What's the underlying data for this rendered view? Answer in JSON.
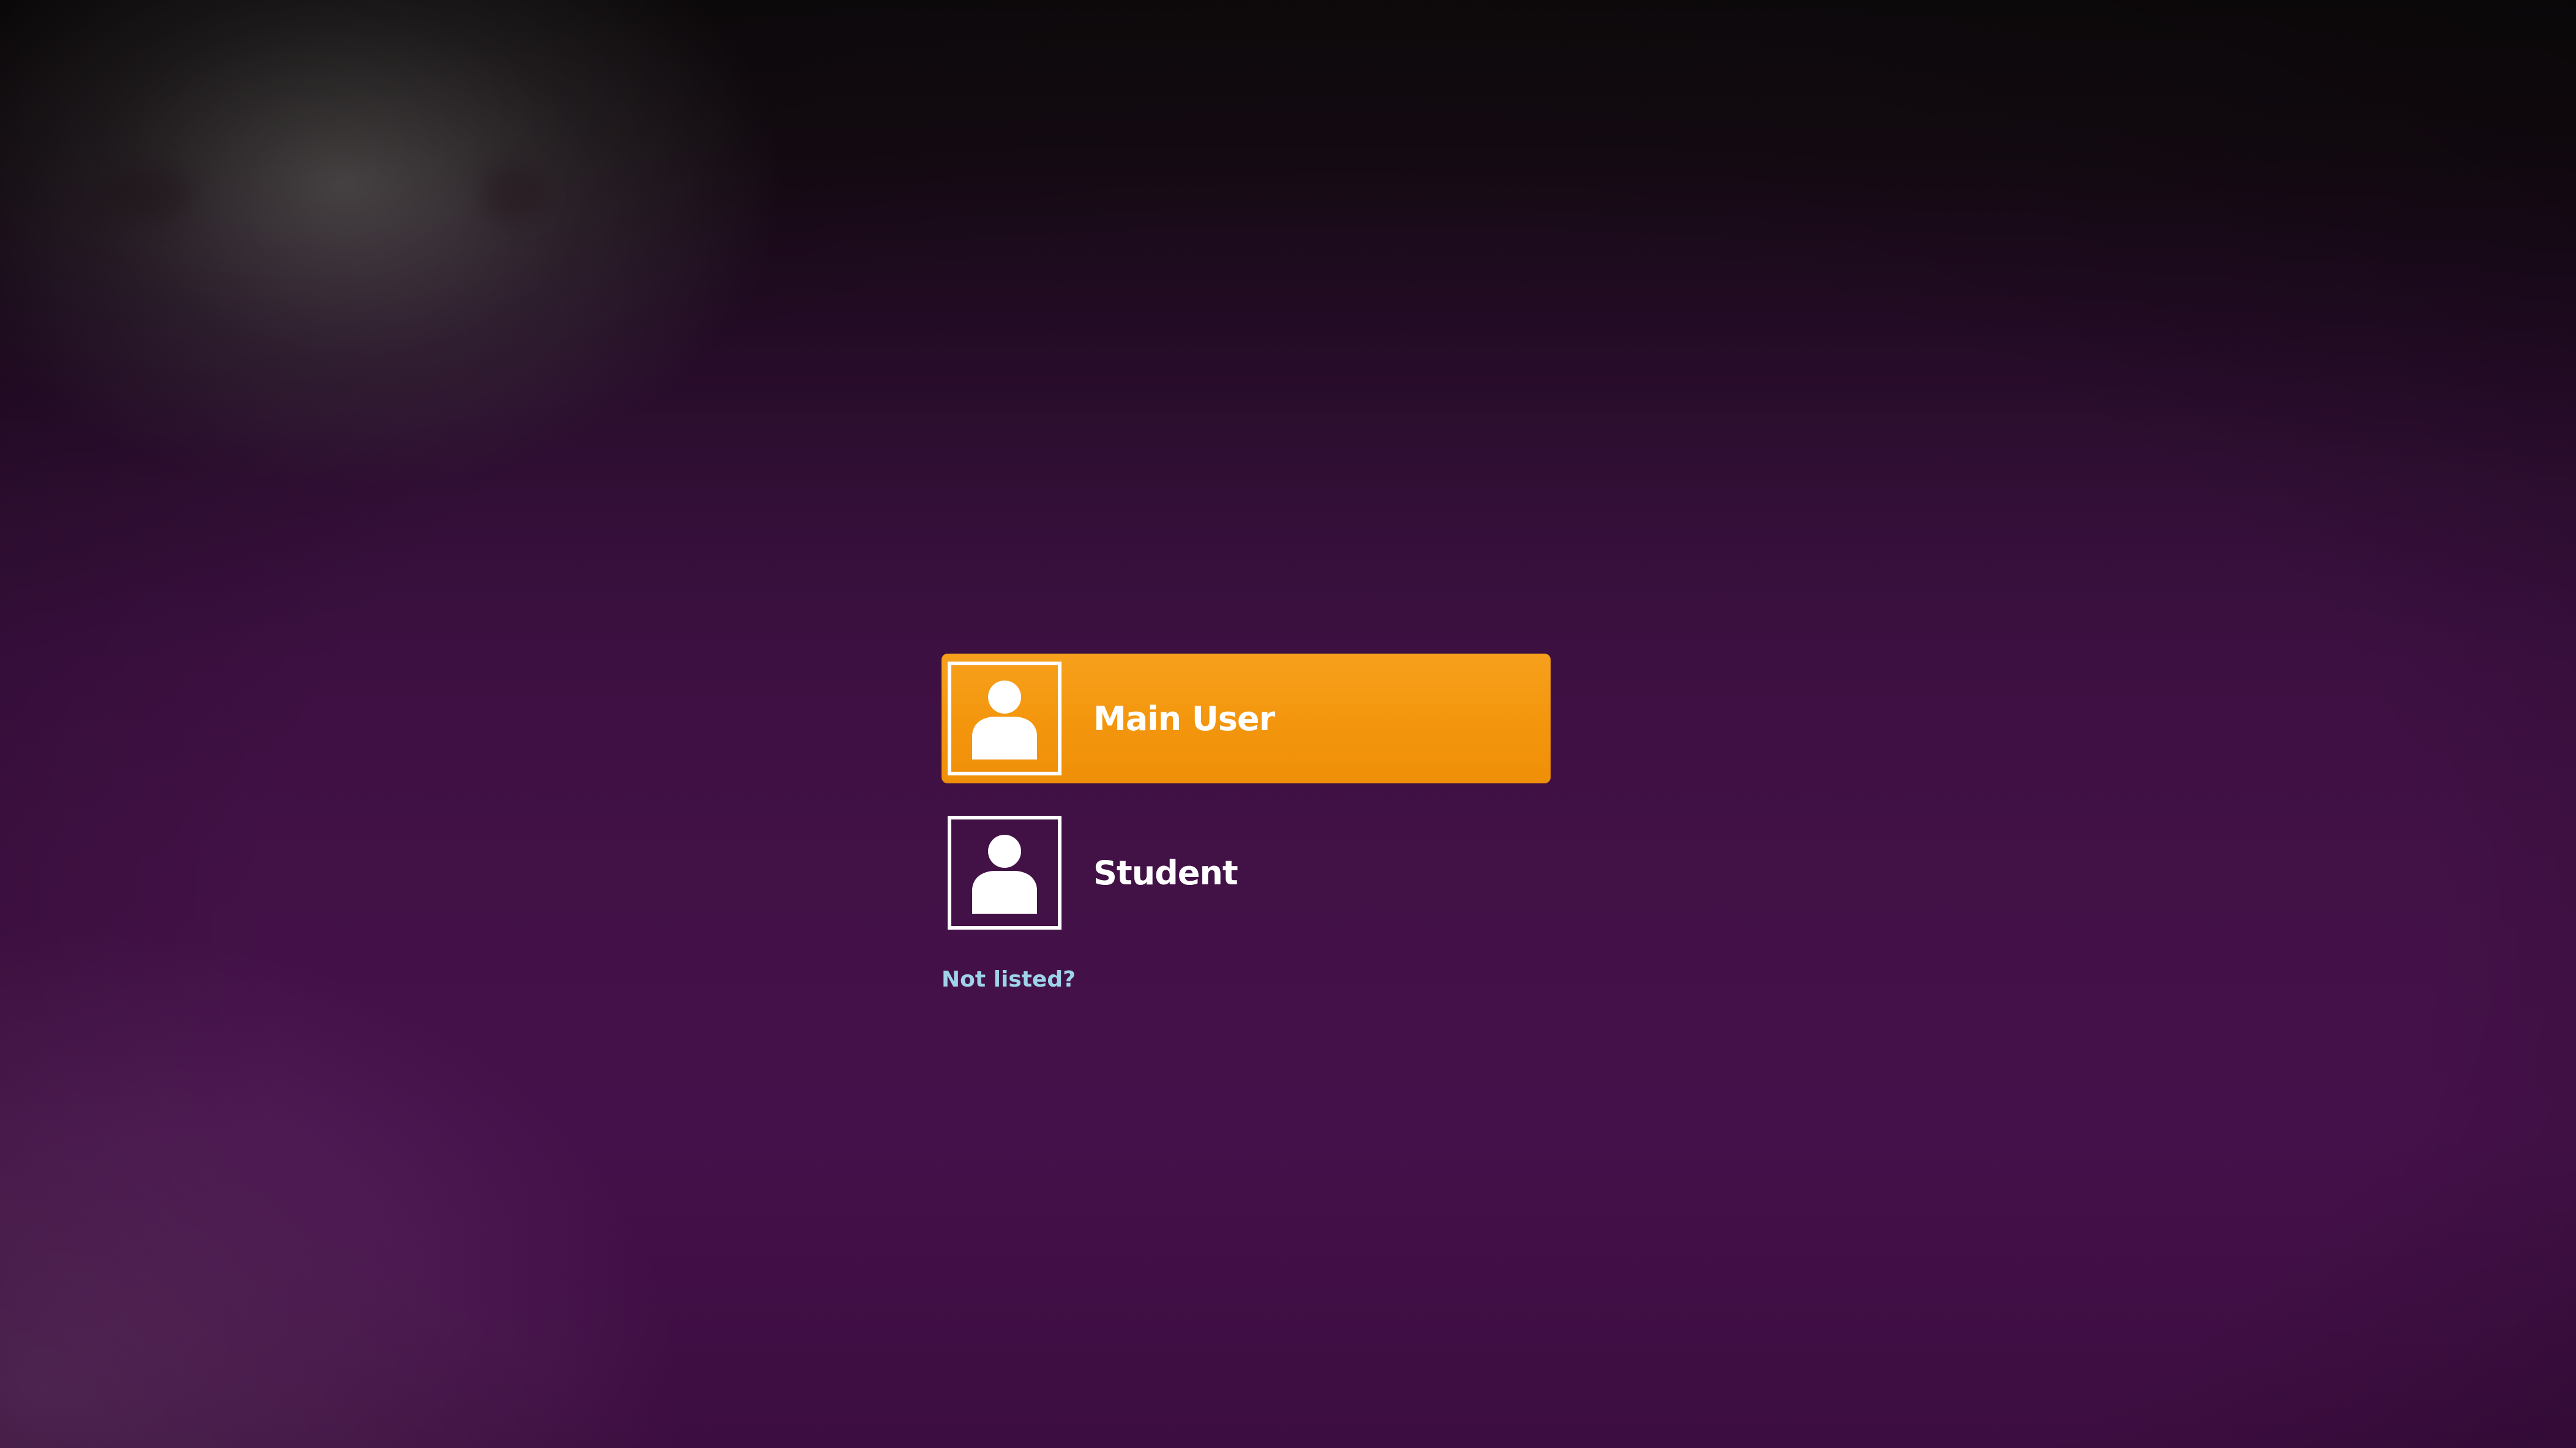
{
  "login": {
    "users": [
      {
        "name": "Main User",
        "selected": true,
        "icon": "user-avatar-icon"
      },
      {
        "name": "Student",
        "selected": false,
        "icon": "user-avatar-icon"
      }
    ],
    "not_listed_label": "Not listed?"
  },
  "colors": {
    "background": "#3e1042",
    "selected_row": "#f3960d",
    "text": "#ffffff",
    "link": "#9fd3ea"
  }
}
